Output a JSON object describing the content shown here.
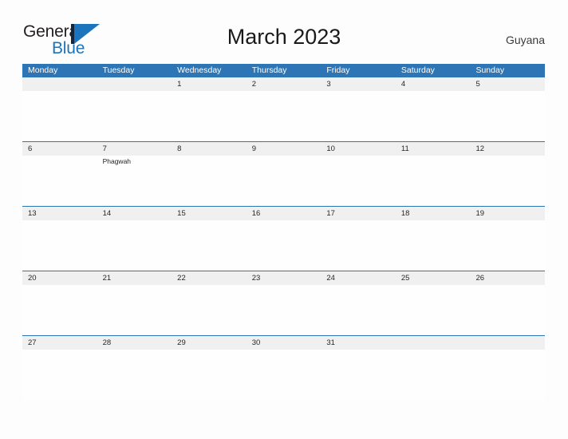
{
  "brand": {
    "word_one": "General",
    "word_two": "Blue",
    "mark_icon": "triangle-flag-icon",
    "colors": {
      "dark": "#231F20",
      "blue": "#1B74BC",
      "navy": "#12263F"
    }
  },
  "header": {
    "title": "March 2023",
    "country": "Guyana"
  },
  "calendar": {
    "colors": {
      "header_blue": "#2E75B6",
      "band_gray": "#F0F0F0",
      "cell_white": "#FEFEFE"
    },
    "weekdays": [
      "Monday",
      "Tuesday",
      "Wednesday",
      "Thursday",
      "Friday",
      "Saturday",
      "Sunday"
    ],
    "weeks": [
      [
        {
          "date": "",
          "events": []
        },
        {
          "date": "",
          "events": []
        },
        {
          "date": "1",
          "events": []
        },
        {
          "date": "2",
          "events": []
        },
        {
          "date": "3",
          "events": []
        },
        {
          "date": "4",
          "events": []
        },
        {
          "date": "5",
          "events": []
        }
      ],
      [
        {
          "date": "6",
          "events": []
        },
        {
          "date": "7",
          "events": [
            "Phagwah"
          ]
        },
        {
          "date": "8",
          "events": []
        },
        {
          "date": "9",
          "events": []
        },
        {
          "date": "10",
          "events": []
        },
        {
          "date": "11",
          "events": []
        },
        {
          "date": "12",
          "events": []
        }
      ],
      [
        {
          "date": "13",
          "events": []
        },
        {
          "date": "14",
          "events": []
        },
        {
          "date": "15",
          "events": []
        },
        {
          "date": "16",
          "events": []
        },
        {
          "date": "17",
          "events": []
        },
        {
          "date": "18",
          "events": []
        },
        {
          "date": "19",
          "events": []
        }
      ],
      [
        {
          "date": "20",
          "events": []
        },
        {
          "date": "21",
          "events": []
        },
        {
          "date": "22",
          "events": []
        },
        {
          "date": "23",
          "events": []
        },
        {
          "date": "24",
          "events": []
        },
        {
          "date": "25",
          "events": []
        },
        {
          "date": "26",
          "events": []
        }
      ],
      [
        {
          "date": "27",
          "events": []
        },
        {
          "date": "28",
          "events": []
        },
        {
          "date": "29",
          "events": []
        },
        {
          "date": "30",
          "events": []
        },
        {
          "date": "31",
          "events": []
        },
        {
          "date": "",
          "events": []
        },
        {
          "date": "",
          "events": []
        }
      ]
    ]
  }
}
